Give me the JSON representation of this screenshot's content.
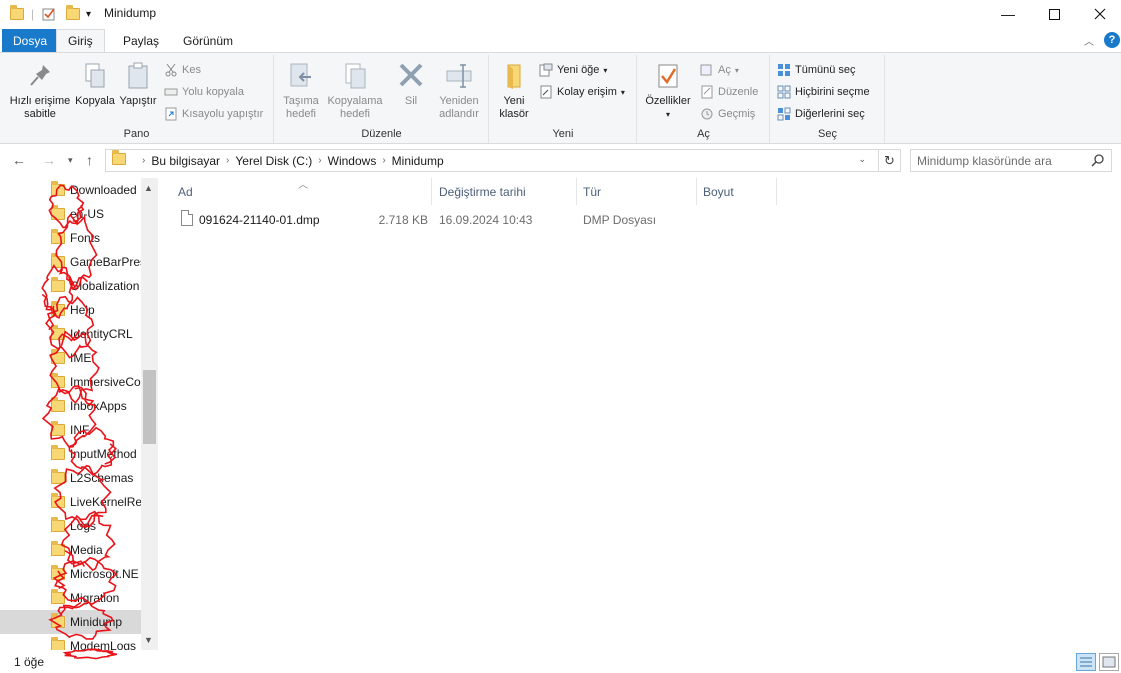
{
  "window": {
    "title": "Minidump",
    "controls": [
      "minimize",
      "maximize",
      "close"
    ]
  },
  "ribbon_tabs": [
    {
      "label": "Dosya"
    },
    {
      "label": "Giriş",
      "active": true
    },
    {
      "label": "Paylaş"
    },
    {
      "label": "Görünüm"
    }
  ],
  "ribbon": {
    "pano": {
      "label": "Pano",
      "pin": "Hızlı erişime sabitle",
      "copy": "Kopyala",
      "paste": "Yapıştır",
      "cut": "Kes",
      "copy_path": "Yolu kopyala",
      "paste_shortcut": "Kısayolu yapıştır"
    },
    "duzenle": {
      "label": "Düzenle",
      "move_to": "Taşıma hedefi",
      "copy_to": "Kopyalama hedefi",
      "delete": "Sil",
      "rename": "Yeniden adlandır"
    },
    "yeni": {
      "label": "Yeni",
      "new_folder": "Yeni klasör",
      "new_item": "Yeni öğe",
      "easy_access": "Kolay erişim"
    },
    "ac": {
      "label": "Aç",
      "properties": "Özellikler",
      "open": "Aç",
      "edit": "Düzenle",
      "history": "Geçmiş"
    },
    "sec": {
      "label": "Seç",
      "select_all": "Tümünü seç",
      "select_none": "Hiçbirini seçme",
      "invert": "Diğerlerini seç"
    }
  },
  "address": {
    "breadcrumb": [
      "Bu bilgisayar",
      "Yerel Disk (C:)",
      "Windows",
      "Minidump"
    ],
    "search_placeholder": "Minidump klasöründe ara"
  },
  "nav_items": [
    {
      "label": "Downloaded"
    },
    {
      "label": "en-US"
    },
    {
      "label": "Fonts"
    },
    {
      "label": "GameBarPres"
    },
    {
      "label": "Globalization"
    },
    {
      "label": "Help"
    },
    {
      "label": "IdentityCRL"
    },
    {
      "label": "IME"
    },
    {
      "label": "ImmersiveCo"
    },
    {
      "label": "InboxApps"
    },
    {
      "label": "INF"
    },
    {
      "label": "InputMethod"
    },
    {
      "label": "L2Schemas"
    },
    {
      "label": "LiveKernelRe"
    },
    {
      "label": "Logs"
    },
    {
      "label": "Media"
    },
    {
      "label": "Microsoft.NE"
    },
    {
      "label": "Migration"
    },
    {
      "label": "Minidump",
      "selected": true
    },
    {
      "label": "ModemLogs"
    }
  ],
  "columns": {
    "name": "Ad",
    "date": "Değiştirme tarihi",
    "type": "Tür",
    "size": "Boyut"
  },
  "files": [
    {
      "name": "091624-21140-01.dmp",
      "date": "16.09.2024 10:43",
      "type": "DMP Dosyası",
      "size": "2.718 KB"
    }
  ],
  "status": {
    "count": "1 öğe"
  },
  "colors": {
    "accent": "#1979ca",
    "annotation": "#e8141a",
    "selected_bg": "#d9d9d9"
  }
}
